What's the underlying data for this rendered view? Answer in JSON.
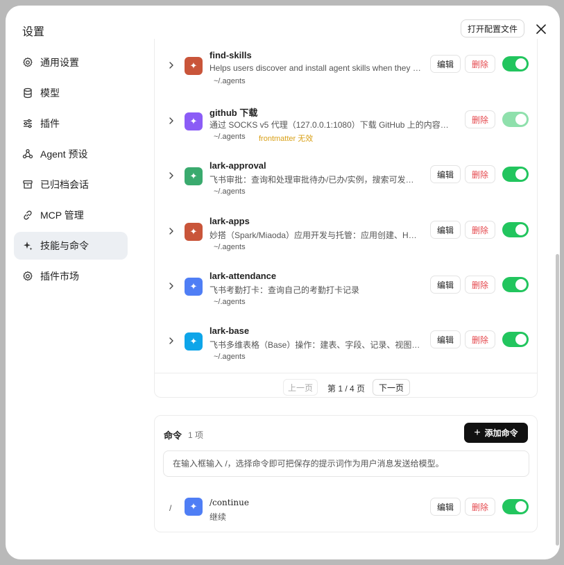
{
  "dialog": {
    "title": "设置",
    "open_config_label": "打开配置文件"
  },
  "sidebar": {
    "items": [
      {
        "label": "通用设置",
        "icon": "gear-icon"
      },
      {
        "label": "模型",
        "icon": "database-icon"
      },
      {
        "label": "插件",
        "icon": "sliders-icon"
      },
      {
        "label": "Agent 预设",
        "icon": "agent-icon"
      },
      {
        "label": "已归档会话",
        "icon": "archive-icon"
      },
      {
        "label": "MCP 管理",
        "icon": "link-icon"
      },
      {
        "label": "技能与命令",
        "icon": "sparkle-icon",
        "active": true
      },
      {
        "label": "插件市场",
        "icon": "gear-icon"
      }
    ]
  },
  "skills": [
    {
      "name": "find-skills",
      "desc": "Helps users discover and install agent skills when they a…",
      "path": "~/.agents",
      "color": "#c9553a",
      "enabled": true,
      "editable": true
    },
    {
      "name": "github 下载",
      "desc": "通过 SOCKS v5 代理（127.0.0.1:1080）下载 GitHub 上的内容。触…",
      "path": "~/.agents",
      "warning": "frontmatter 无效",
      "color": "#8b5cf6",
      "enabled": true,
      "editable": false
    },
    {
      "name": "lark-approval",
      "desc": "飞书审批：查询和处理审批待办/已办/实例，搜索可发起…",
      "path": "~/.agents",
      "color": "#3aaa6e",
      "enabled": true,
      "editable": true
    },
    {
      "name": "lark-apps",
      "desc": "妙搭（Spark/Miaoda）应用开发与托管：应用创建、HT…",
      "path": "~/.agents",
      "color": "#c9553a",
      "enabled": true,
      "editable": true
    },
    {
      "name": "lark-attendance",
      "desc": "飞书考勤打卡：查询自己的考勤打卡记录",
      "path": "~/.agents",
      "color": "#4f7ef5",
      "enabled": true,
      "editable": true
    },
    {
      "name": "lark-base",
      "desc": "飞书多维表格（Base）操作：建表、字段、记录、视图…",
      "path": "~/.agents",
      "color": "#0ea5e9",
      "enabled": true,
      "editable": true
    }
  ],
  "actions": {
    "edit_label": "编辑",
    "delete_label": "删除"
  },
  "pagination": {
    "prev_label": "上一页",
    "info": "第 1 / 4 页",
    "next_label": "下一页"
  },
  "commands": {
    "title": "命令",
    "count": "1 项",
    "add_label": "添加命令",
    "hint": "在输入框输入 /，选择命令即可把保存的提示词作为用户消息发送给模型。",
    "items": [
      {
        "slash": "/",
        "name": "/continue",
        "desc": "继续",
        "color": "#4f7ef5",
        "enabled": true
      }
    ]
  },
  "colors": {
    "toggle_on": "#22c55e",
    "delete_text": "#e5484d",
    "warning_text": "#d9a017",
    "primary_button": "#111111"
  }
}
